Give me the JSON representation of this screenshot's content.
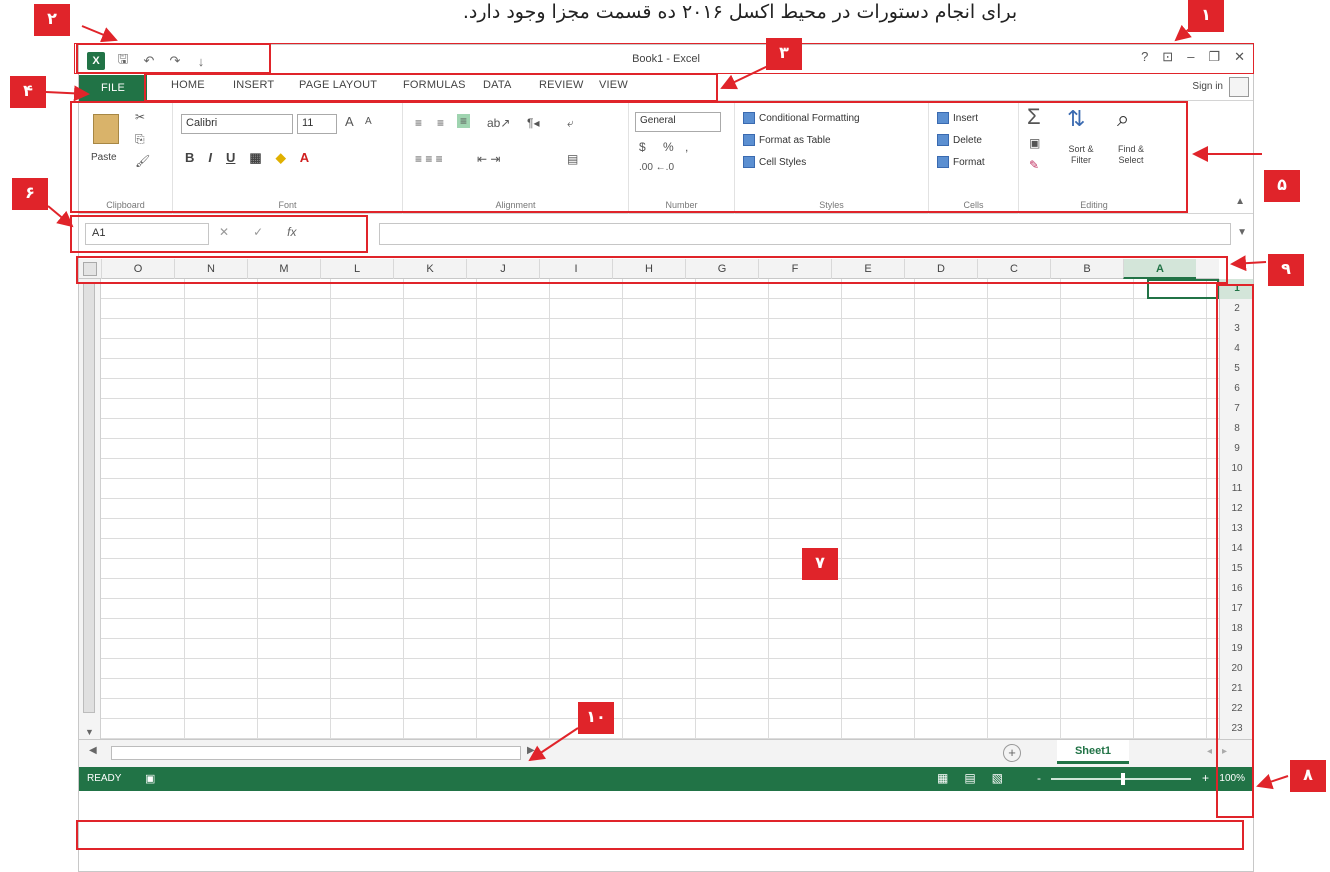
{
  "caption": "برای انجام دستورات در محیط اکسل ۲۰۱۶ ده قسمت مجزا وجود دارد.",
  "window": {
    "title": "Book1 - Excel",
    "logo": "X",
    "controls": {
      "help": "?",
      "ribbon_options": "⊡",
      "minimize": "–",
      "restore": "❐",
      "close": "✕"
    }
  },
  "qat": {
    "save_icon": "🖫",
    "undo_icon": "↶",
    "redo_icon": "↷",
    "customize_icon": "↓"
  },
  "tabs": {
    "file": "FILE",
    "home": "HOME",
    "insert": "INSERT",
    "page_layout": "PAGE LAYOUT",
    "formulas": "FORMULAS",
    "data": "DATA",
    "review": "REVIEW",
    "view": "VIEW"
  },
  "signin": "Sign in",
  "ribbon": {
    "clipboard": {
      "paste": "Paste",
      "label": "Clipboard"
    },
    "font": {
      "name": "Calibri",
      "size": "11",
      "bold": "B",
      "italic": "I",
      "underline": "U",
      "grow": "A",
      "shrink": "A",
      "color_a": "A",
      "label": "Font"
    },
    "alignment": {
      "label": "Alignment"
    },
    "number": {
      "format": "General",
      "currency": "$",
      "percent": "%",
      "comma": ",",
      "inc_dec": ".00 ←.0",
      "label": "Number"
    },
    "styles": {
      "conditional": "Conditional Formatting",
      "table": "Format as Table",
      "cell_styles": "Cell Styles",
      "label": "Styles"
    },
    "cells": {
      "insert": "Insert",
      "delete": "Delete",
      "format": "Format",
      "label": "Cells"
    },
    "editing": {
      "sort": "Sort & Filter",
      "find": "Find & Select",
      "label": "Editing"
    }
  },
  "formula_bar": {
    "name_box": "A1",
    "cancel": "✕",
    "enter": "✓",
    "fx": "fx"
  },
  "columns": [
    "O",
    "N",
    "M",
    "L",
    "K",
    "J",
    "I",
    "H",
    "G",
    "F",
    "E",
    "D",
    "C",
    "B",
    "A"
  ],
  "selected_column": "A",
  "rows": [
    "1",
    "2",
    "3",
    "4",
    "5",
    "6",
    "7",
    "8",
    "9",
    "10",
    "11",
    "12",
    "13",
    "14",
    "15",
    "16",
    "17",
    "18",
    "19",
    "20",
    "21",
    "22",
    "23"
  ],
  "selected_row": "1",
  "sheet": {
    "tab": "Sheet1",
    "new_sheet": "+"
  },
  "status": {
    "ready": "READY",
    "zoom": "100%",
    "zoom_minus": "-",
    "zoom_plus": "+"
  },
  "callouts": {
    "c1": "۱",
    "c2": "۲",
    "c3": "۳",
    "c4": "۴",
    "c5": "۵",
    "c6": "۶",
    "c7": "۷",
    "c8": "۸",
    "c9": "۹",
    "c10": "۱۰"
  },
  "colors": {
    "excel_green": "#217346",
    "callout_red": "#e0242a"
  }
}
